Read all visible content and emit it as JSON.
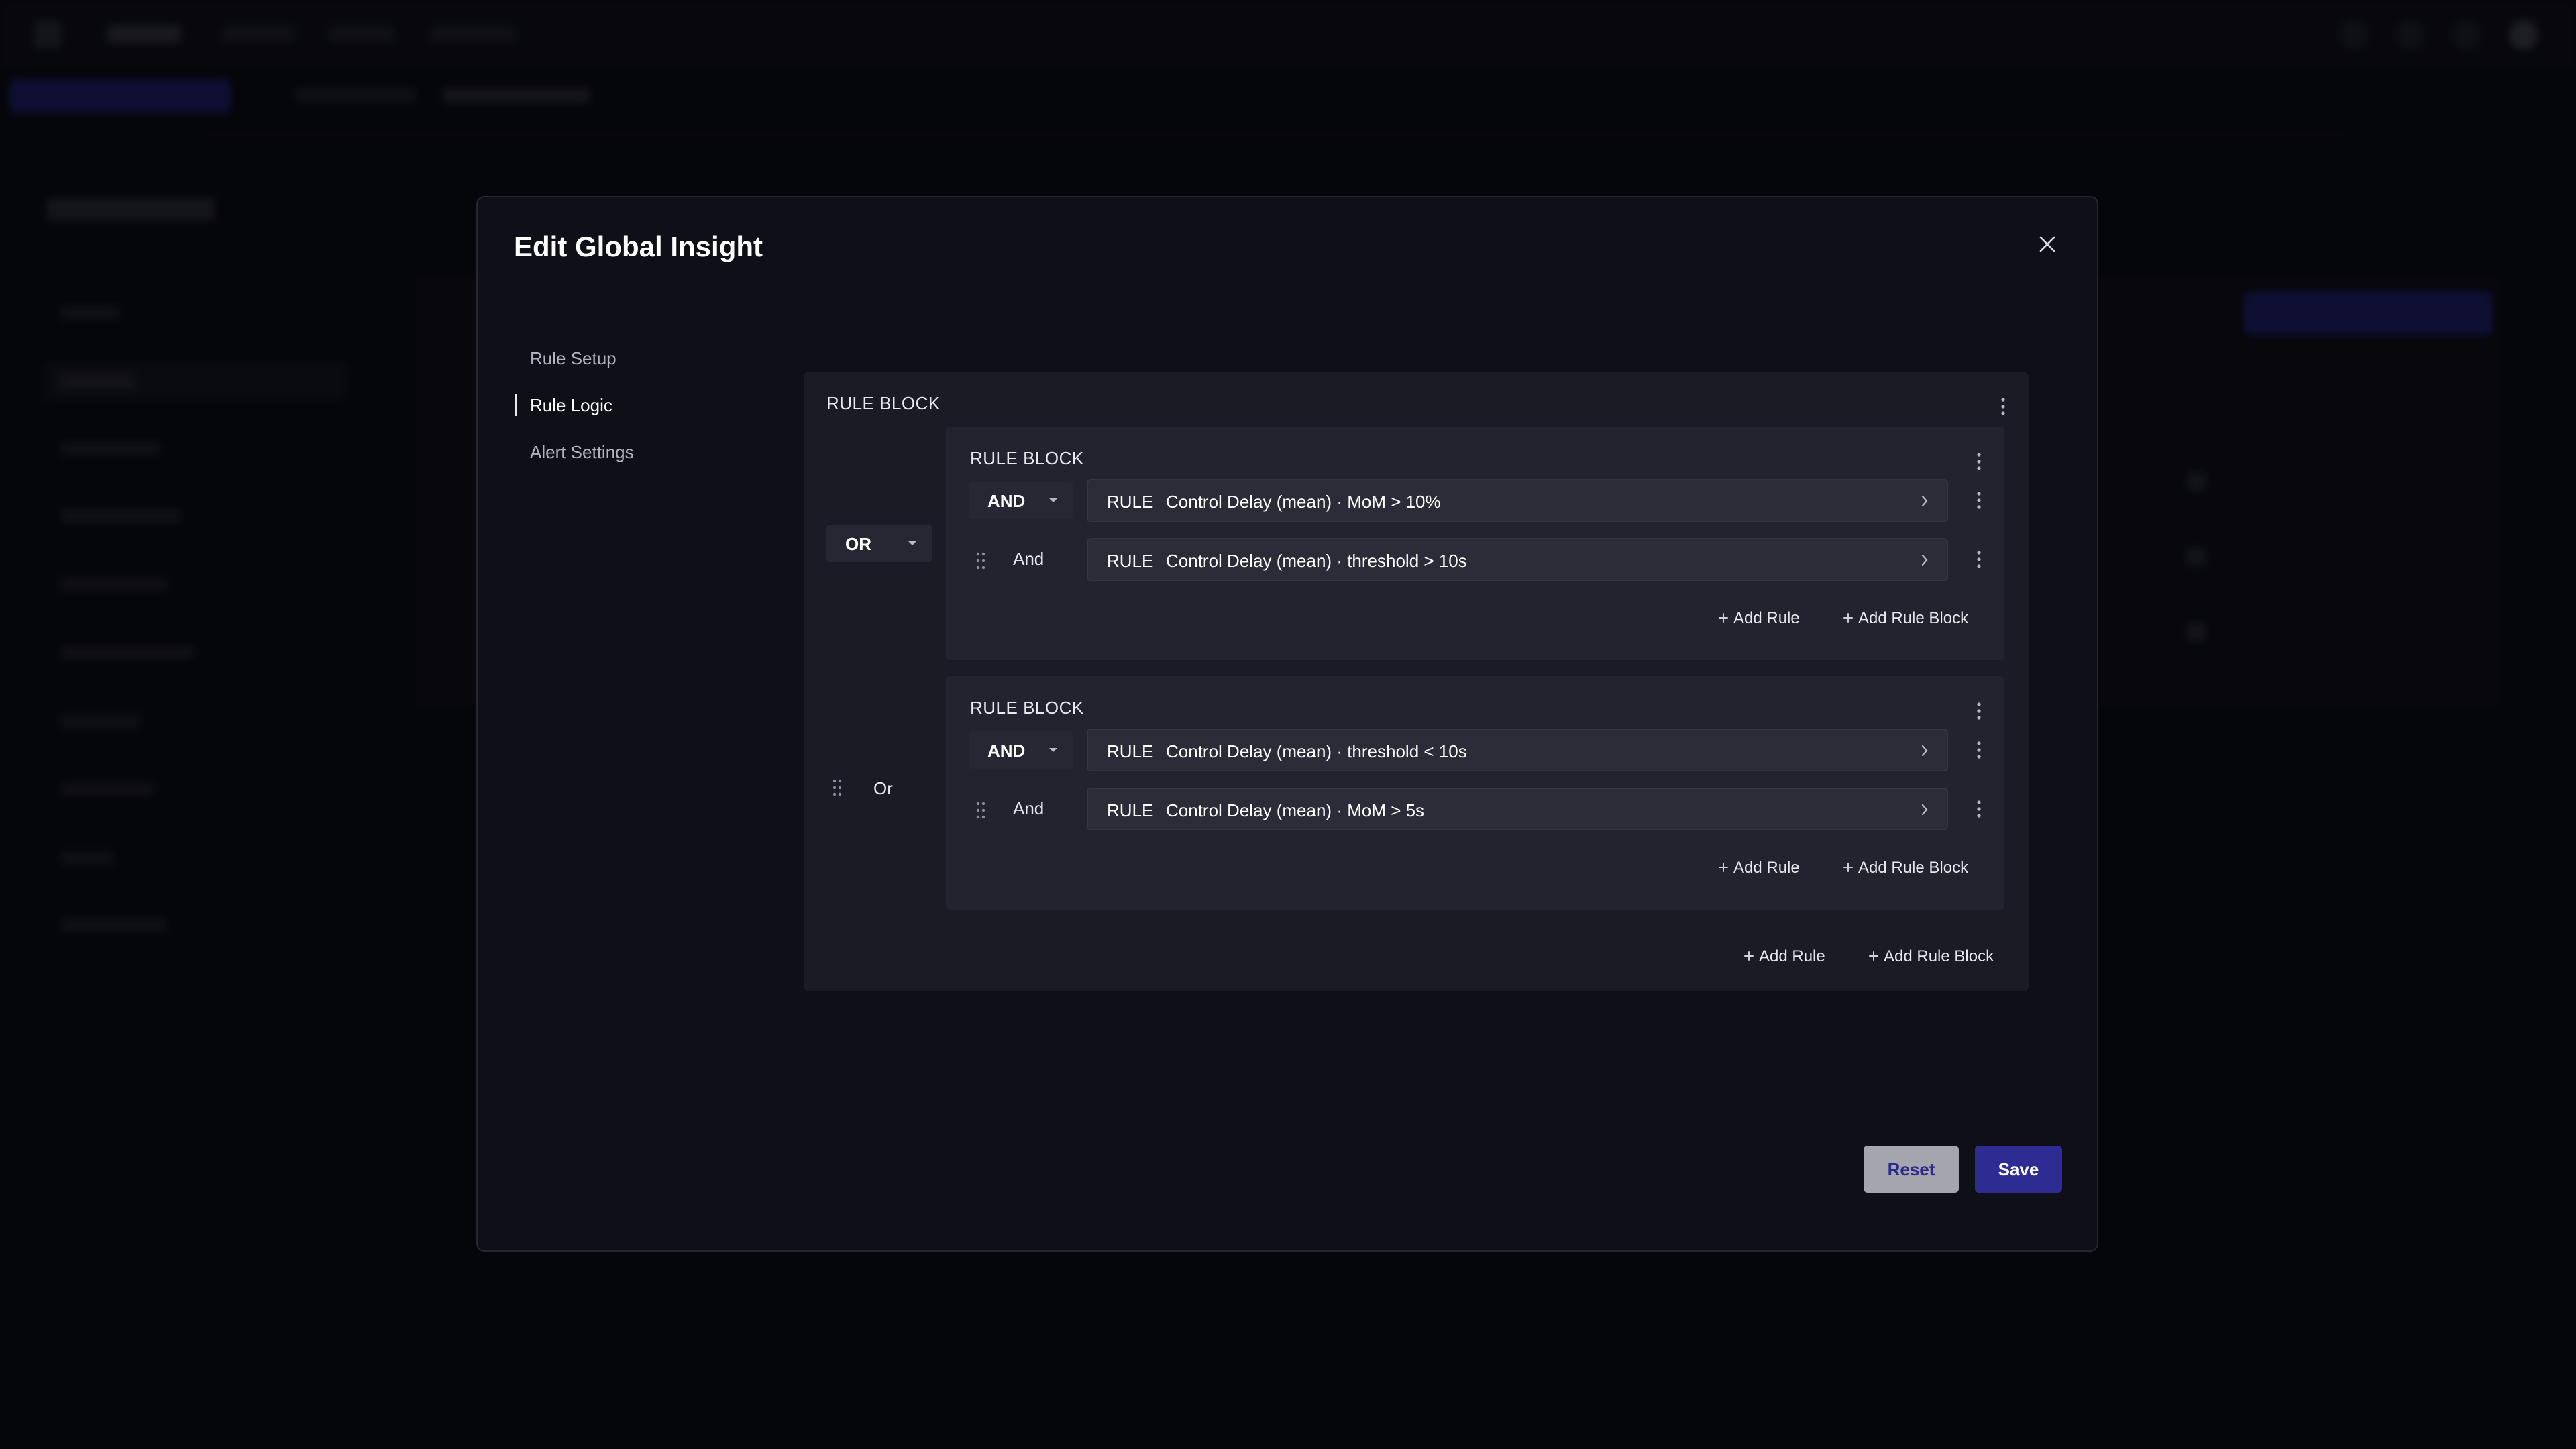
{
  "modal": {
    "title": "Edit Global Insight",
    "reset_label": "Reset",
    "save_label": "Save"
  },
  "nav": {
    "items": [
      {
        "label": "Rule Setup",
        "active": false
      },
      {
        "label": "Rule Logic",
        "active": true
      },
      {
        "label": "Alert Settings",
        "active": false
      }
    ]
  },
  "rule_logic": {
    "outer_block": {
      "label": "RULE BLOCK",
      "operator": "OR",
      "second_connector": "Or",
      "add_rule_label": "Add Rule",
      "add_block_label": "Add Rule Block"
    },
    "blocks": [
      {
        "label": "RULE BLOCK",
        "operator": "AND",
        "connector": "And",
        "rules": [
          {
            "tag": "RULE",
            "text": "Control Delay (mean) · MoM > 10%"
          },
          {
            "tag": "RULE",
            "text": "Control Delay (mean) · threshold > 10s"
          }
        ],
        "add_rule_label": "Add Rule",
        "add_block_label": "Add Rule Block"
      },
      {
        "label": "RULE BLOCK",
        "operator": "AND",
        "connector": "And",
        "rules": [
          {
            "tag": "RULE",
            "text": "Control Delay (mean) · threshold < 10s"
          },
          {
            "tag": "RULE",
            "text": "Control Delay (mean) · MoM > 5s"
          }
        ],
        "add_rule_label": "Add Rule",
        "add_block_label": "Add Rule Block"
      }
    ]
  },
  "icons": {
    "close": "close-icon",
    "more": "kebab-icon",
    "drag": "drag-handle-icon",
    "caret": "caret-down-icon",
    "chevron": "chevron-right-icon",
    "plus": "plus-icon"
  },
  "colors": {
    "modal_bg": "#0e0f17",
    "block_bg": "#1a1b25",
    "inner_block_bg": "#22232e",
    "rule_row_bg": "#2b2c38",
    "save_button": "#2e2c93",
    "reset_button": "#a5a6ad"
  }
}
